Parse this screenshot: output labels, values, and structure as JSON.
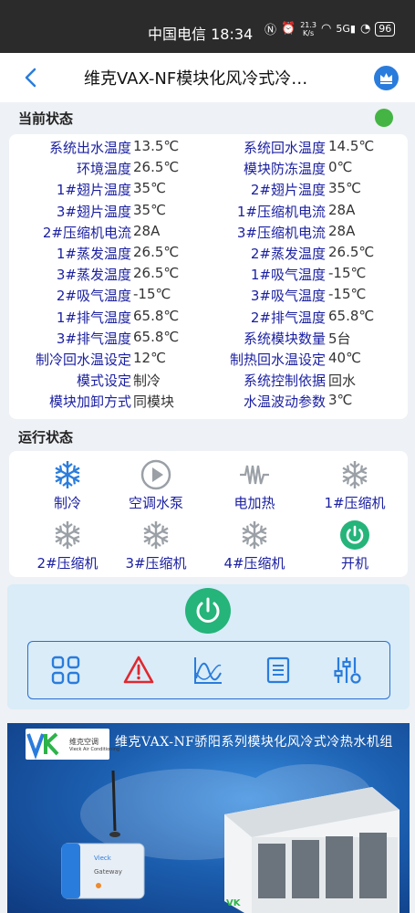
{
  "status_bar": {
    "carrier_time": "中国电信 18:34",
    "speed": "21.3",
    "speed_unit": "K/s",
    "battery": "96"
  },
  "header": {
    "title": "维克VAX-NF模块化风冷式冷…"
  },
  "current_status": {
    "heading": "当前状态",
    "indicator_color": "#44b544",
    "rows": [
      {
        "l1": "系统出水温度",
        "v1": "13.5℃",
        "l2": "系统回水温度",
        "v2": "14.5℃"
      },
      {
        "l1": "环境温度",
        "v1": "26.5℃",
        "l2": "模块防冻温度",
        "v2": "0℃"
      },
      {
        "l1": "1#翅片温度",
        "v1": "35℃",
        "l2": "2#翅片温度",
        "v2": "35℃"
      },
      {
        "l1": "3#翅片温度",
        "v1": "35℃",
        "l2": "1#压缩机电流",
        "v2": "28A"
      },
      {
        "l1": "2#压缩机电流",
        "v1": "28A",
        "l2": "3#压缩机电流",
        "v2": "28A"
      },
      {
        "l1": "1#蒸发温度",
        "v1": "26.5℃",
        "l2": "2#蒸发温度",
        "v2": "26.5℃"
      },
      {
        "l1": "3#蒸发温度",
        "v1": "26.5℃",
        "l2": "1#吸气温度",
        "v2": "-15℃"
      },
      {
        "l1": "2#吸气温度",
        "v1": "-15℃",
        "l2": "3#吸气温度",
        "v2": "-15℃"
      },
      {
        "l1": "1#排气温度",
        "v1": "65.8℃",
        "l2": "2#排气温度",
        "v2": "65.8℃"
      },
      {
        "l1": "3#排气温度",
        "v1": "65.8℃",
        "l2": "系统模块数量",
        "v2": "5台"
      },
      {
        "l1": "制冷回水温设定",
        "v1": "12℃",
        "l2": "制热回水温设定",
        "v2": "40℃"
      },
      {
        "l1": "模式设定",
        "v1": "制冷",
        "l2": "系统控制依据",
        "v2": "回水"
      },
      {
        "l1": "模块加卸方式",
        "v1": "同模块",
        "l2": "水温波动参数",
        "v2": "3℃"
      }
    ]
  },
  "run_status": {
    "heading": "运行状态",
    "items": [
      {
        "label": "制冷",
        "icon": "snowflake-icon",
        "active": true
      },
      {
        "label": "空调水泵",
        "icon": "play-icon",
        "active": false
      },
      {
        "label": "电加热",
        "icon": "heater-coil-icon",
        "active": false
      },
      {
        "label": "1#压缩机",
        "icon": "snowflake-icon",
        "active": false
      },
      {
        "label": "2#压缩机",
        "icon": "snowflake-icon",
        "active": false
      },
      {
        "label": "3#压缩机",
        "icon": "snowflake-icon",
        "active": false
      },
      {
        "label": "4#压缩机",
        "icon": "snowflake-icon",
        "active": false
      },
      {
        "label": "开机",
        "icon": "power-icon",
        "active": true
      }
    ]
  },
  "control_panel": {
    "power_icon": "power-icon",
    "tools": [
      "dashboard-grid-icon",
      "alarm-warning-icon",
      "curve-chart-icon",
      "list-document-icon",
      "settings-sliders-icon"
    ]
  },
  "banner": {
    "title": "维克VAX-NF骄阳系列模块化风冷式冷热水机组",
    "logo_text": "维克空调",
    "logo_sub": "Vieck Air Conditioning",
    "logo_mark": "VK",
    "gateway_label": "Gateway",
    "brand_small": "Vieck"
  },
  "colors": {
    "accent": "#1a1fa0",
    "active_blue": "#2a7cdc",
    "active_green": "#25b47a",
    "inactive": "#9aa0a6",
    "alarm": "#e0282e"
  }
}
